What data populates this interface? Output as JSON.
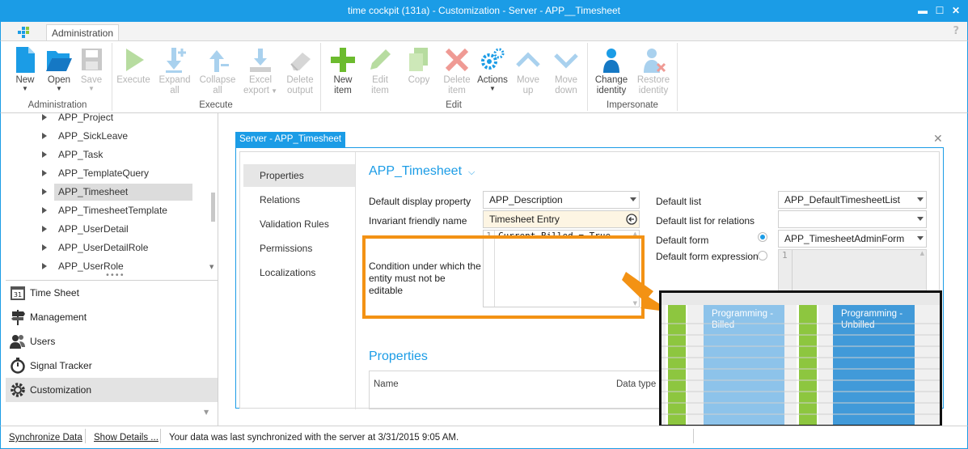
{
  "window": {
    "title": "time cockpit (131a) - Customization - Server - APP__Timesheet"
  },
  "tabs": {
    "administration": "Administration",
    "help": "?"
  },
  "ribbon": {
    "new": "New",
    "open": "Open",
    "save": "Save",
    "execute": "Execute",
    "expand_all_1": "Expand",
    "expand_all_2": "all",
    "collapse_all_1": "Collapse",
    "collapse_all_2": "all",
    "excel_export_1": "Excel",
    "excel_export_2": "export",
    "delete_output_1": "Delete",
    "delete_output_2": "output",
    "new_item_1": "New",
    "new_item_2": "item",
    "edit_item_1": "Edit",
    "edit_item_2": "item",
    "copy": "Copy",
    "delete_item_1": "Delete",
    "delete_item_2": "item",
    "actions": "Actions",
    "move_up_1": "Move",
    "move_up_2": "up",
    "move_down_1": "Move",
    "move_down_2": "down",
    "change_identity_1": "Change",
    "change_identity_2": "identity",
    "restore_identity_1": "Restore",
    "restore_identity_2": "identity",
    "groups": {
      "administration": "Administration",
      "execute": "Execute",
      "edit": "Edit",
      "impersonate": "Impersonate"
    }
  },
  "tree": {
    "items": [
      "APP_Project",
      "APP_SickLeave",
      "APP_Task",
      "APP_TemplateQuery",
      "APP_Timesheet",
      "APP_TimesheetTemplate",
      "APP_UserDetail",
      "APP_UserDetailRole",
      "APP_UserRole"
    ],
    "selected": "APP_Timesheet"
  },
  "nav": {
    "items": [
      "Time Sheet",
      "Management",
      "Users",
      "Signal Tracker",
      "Customization"
    ],
    "selected": "Customization"
  },
  "status": {
    "sync": "Synchronize Data",
    "details": "Show Details ...",
    "message": "Your data was last synchronized with the server at 3/31/2015 9:05 AM."
  },
  "document": {
    "tab": "Server - APP_Timesheet",
    "close": "✕",
    "side_items": [
      "Properties",
      "Relations",
      "Validation Rules",
      "Permissions",
      "Localizations"
    ],
    "side_selected": "Properties",
    "entity_title": "APP_Timesheet",
    "fields": {
      "default_display_property_label": "Default display property",
      "default_display_property_value": "APP_Description",
      "invariant_friendly_name_label": "Invariant friendly name",
      "invariant_friendly_name_value": "Timesheet Entry",
      "condition_label": "Condition under which the entity must not be editable",
      "condition_line": "1",
      "condition_code": "Current.Billed = True",
      "default_list_label": "Default list",
      "default_list_value": "APP_DefaultTimesheetList",
      "default_list_relations_label": "Default list for relations",
      "default_list_relations_value": "",
      "default_form_label": "Default form",
      "default_form_value": "APP_TimesheetAdminForm",
      "default_form_expression_label": "Default form expression",
      "default_form_expression_line": "1"
    },
    "properties_title": "Properties",
    "grid_headers": [
      "Name",
      "Data type"
    ]
  },
  "overlay": {
    "billed": "Programming - Billed",
    "unbilled": "Programming - Unbilled"
  },
  "colors": {
    "accent": "#1b9ce6",
    "highlight": "#f39214",
    "green": "#8dc63f"
  }
}
